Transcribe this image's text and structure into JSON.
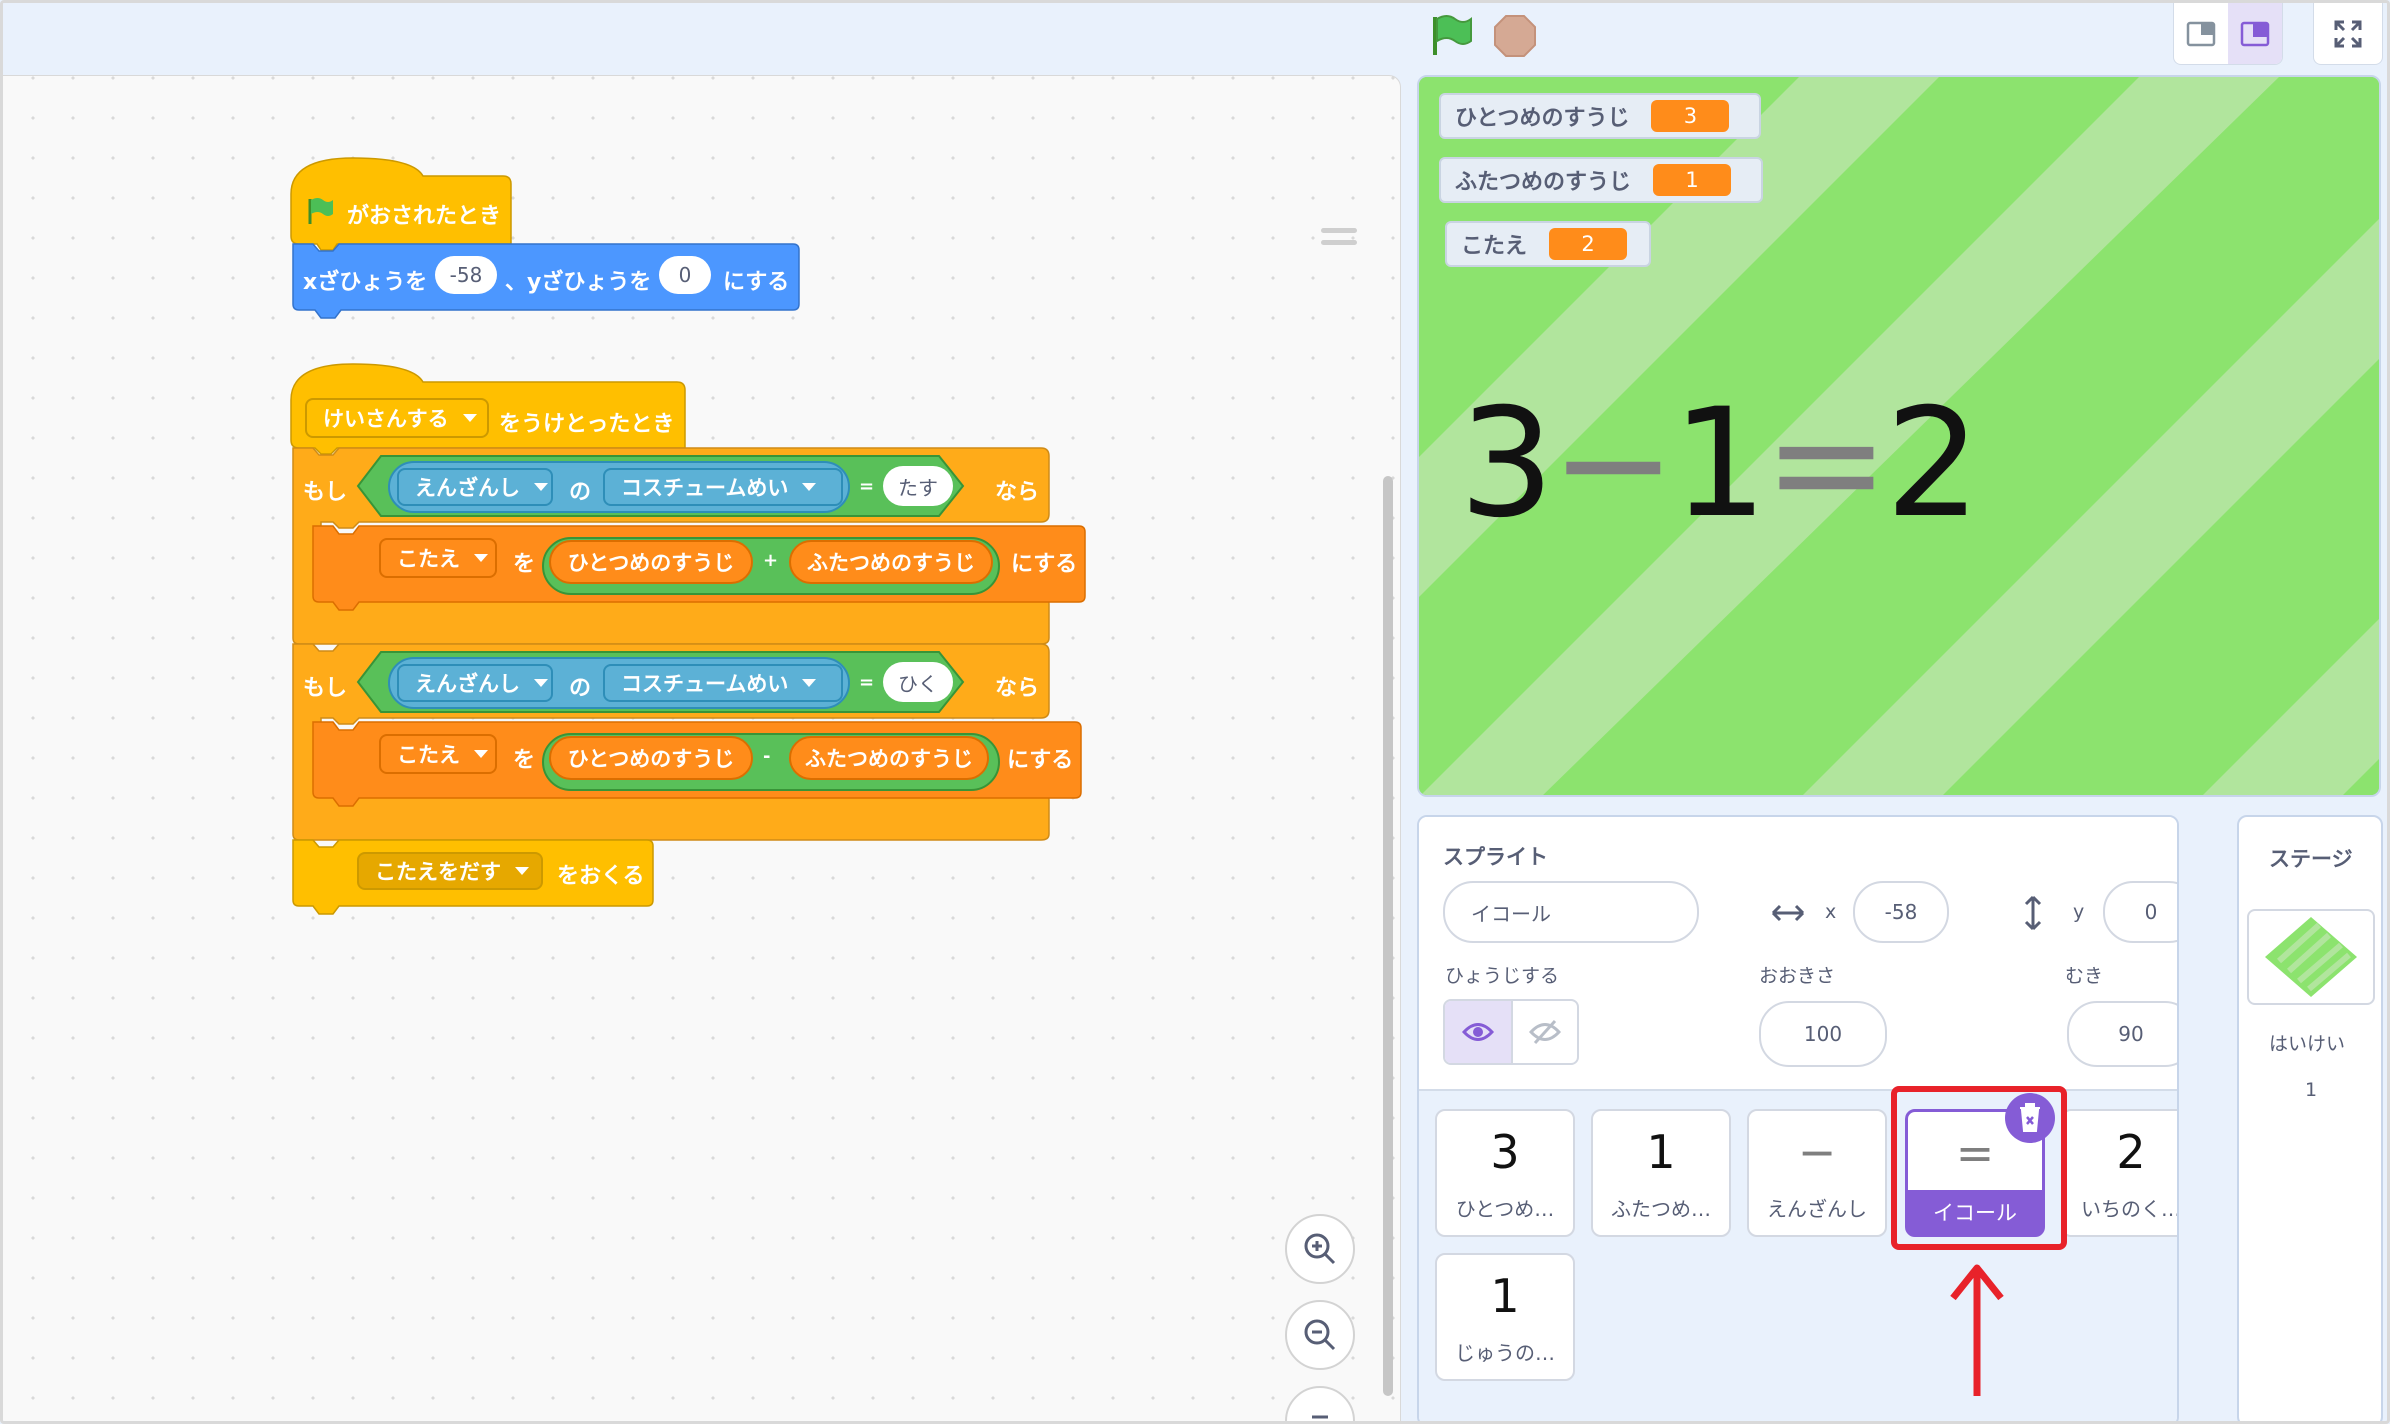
{
  "toolbar": {
    "flag_icon": "green-flag-icon",
    "stop_icon": "stop-icon"
  },
  "code": {
    "hat1_label": "がおされたとき",
    "goto_label1": "xざひょうを",
    "goto_x": "-58",
    "goto_sep": "、yざひょうを",
    "goto_y": "0",
    "goto_label2": "にする",
    "hat2_dropdown": "けいさんする",
    "hat2_label": "をうけとったとき",
    "if1_label": "もし",
    "if1_then": "なら",
    "of1_target": "えんざんし",
    "of1_of": "の",
    "of1_prop": "コスチュームめい",
    "eq1_sign": "=",
    "eq1_value": "たす",
    "set1_var": "こたえ",
    "set1_wo": "を",
    "set1_a": "ひとつめのすうじ",
    "set1_op": "+",
    "set1_b": "ふたつめのすうじ",
    "set1_suffix": "にする",
    "if2_label": "もし",
    "if2_then": "なら",
    "of2_target": "えんざんし",
    "of2_of": "の",
    "of2_prop": "コスチュームめい",
    "eq2_sign": "=",
    "eq2_value": "ひく",
    "set2_var": "こたえ",
    "set2_wo": "を",
    "set2_a": "ひとつめのすうじ",
    "set2_op": "-",
    "set2_b": "ふたつめのすうじ",
    "set2_suffix": "にする",
    "bc_message": "こたえをだす",
    "bc_label": "をおくる"
  },
  "stage": {
    "monitors": [
      {
        "label": "ひとつめのすうじ",
        "value": "3"
      },
      {
        "label": "ふたつめのすうじ",
        "value": "1"
      },
      {
        "label": "こたえ",
        "value": "2"
      }
    ],
    "eq_a": "3",
    "eq_op": "−",
    "eq_b": "1",
    "eq_eq": "=",
    "eq_c": "2"
  },
  "sprite_info": {
    "title": "スプライト",
    "name": "イコール",
    "x_label": "x",
    "x_value": "-58",
    "y_label": "y",
    "y_value": "0",
    "show_label": "ひょうじする",
    "size_label": "おおきさ",
    "size_value": "100",
    "dir_label": "むき",
    "dir_value": "90"
  },
  "sprites": [
    {
      "glyph": "3",
      "name": "ひとつめ…",
      "selected": false
    },
    {
      "glyph": "1",
      "name": "ふたつめ…",
      "selected": false
    },
    {
      "glyph": "−",
      "name": "えんざんし",
      "selected": false
    },
    {
      "glyph": "=",
      "name": "イコール",
      "selected": true
    },
    {
      "glyph": "2",
      "name": "いちのく…",
      "selected": false
    },
    {
      "glyph": "1",
      "name": "じゅうの…",
      "selected": false
    }
  ],
  "stage_panel": {
    "title": "ステージ",
    "name": "はいけい",
    "count": "1"
  },
  "colors": {
    "motion": "#4c97ff",
    "events": "#ffbf00",
    "control": "#ffab19",
    "operators": "#59c059",
    "sensing": "#5cb1d6",
    "variables": "#ff8c1a",
    "highlight": "#e8222a",
    "accent": "#855cd6"
  }
}
